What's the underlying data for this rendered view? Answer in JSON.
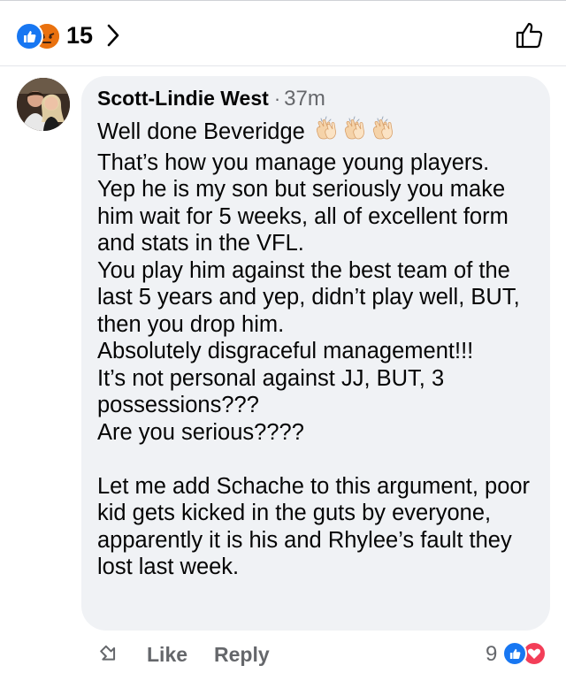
{
  "top_bar": {
    "reaction_icons": [
      "like-reaction-icon",
      "angry-reaction-icon"
    ],
    "reaction_count": "15",
    "chevron_icon": "chevron-right-icon",
    "like_icon": "thumbs-up-outline-icon"
  },
  "comment": {
    "author": "Scott-Lindie West",
    "separator": "·",
    "time": "37m",
    "lines": {
      "l1": "Well done Beveridge",
      "l2": "That’s how you manage young players.",
      "l3": "Yep he is my son but seriously you make him wait for 5 weeks, all of excellent form and stats in the VFL.",
      "l4": "You play him against the best team of the last 5 years and yep, didn’t play well, BUT, then you drop him.",
      "l5": "Absolutely disgraceful management!!!",
      "l6": "It’s not personal against JJ, BUT, 3 possessions???",
      "l7": "Are you serious????",
      "l8": "Let me add Schache to this argument, poor kid gets kicked in the guts by everyone, apparently it is his and Rhylee’s fault they lost last week."
    },
    "emoji": [
      "clapping-hands-icon",
      "clapping-hands-icon",
      "clapping-hands-icon"
    ]
  },
  "actions": {
    "like_label": "Like",
    "reply_label": "Reply",
    "reaction_count": "9",
    "reaction_icons": [
      "like-reaction-icon",
      "love-reaction-icon"
    ]
  },
  "colors": {
    "bubble": "#f0f2f5",
    "facebook_blue": "#1877f2",
    "secondary_text": "#65676b",
    "love_red": "#f33e58",
    "angry_orange": "#f7a533"
  }
}
